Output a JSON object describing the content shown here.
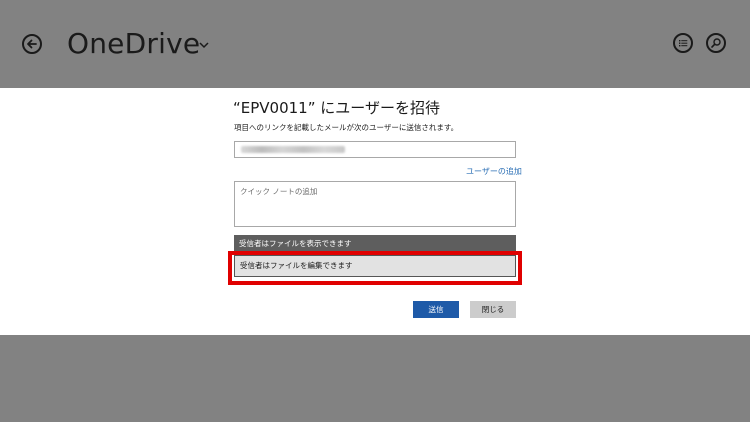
{
  "app": {
    "title": "OneDrive"
  },
  "dialog": {
    "title": "“EPV0011” にユーザーを招待",
    "subtitle": "項目へのリンクを記載したメールが次のユーザーに送信されます。",
    "add_user_link": "ユーザーの追加",
    "note_placeholder": "クイック ノートの追加",
    "permissions": {
      "view": "受信者はファイルを表示できます",
      "edit": "受信者はファイルを編集できます"
    },
    "send_label": "送信",
    "close_label": "閉じる"
  },
  "colors": {
    "background": "#828282",
    "dialog": "#ffffff",
    "accent": "#1e5aa8",
    "link": "#2b6fb5",
    "highlight": "#e00000"
  },
  "icons": [
    "back-arrow-icon",
    "chevron-down-icon",
    "list-icon",
    "search-icon"
  ]
}
